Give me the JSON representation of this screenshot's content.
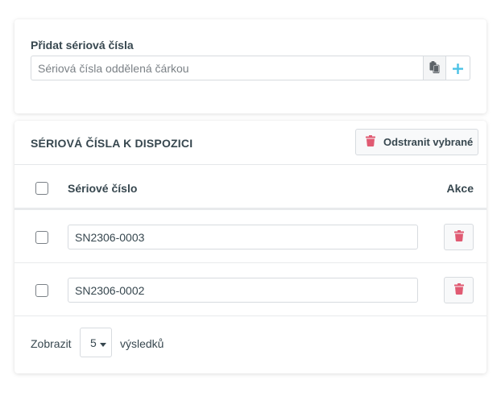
{
  "add_section": {
    "label": "Přidat sériová čísla",
    "input_placeholder": "Sériová čísla oddělená čárkou",
    "input_value": ""
  },
  "list_section": {
    "title": "SÉRIOVÁ ČÍSLA K DISPOZICI",
    "remove_selected_label": "Odstranit vybrané",
    "columns": {
      "serial": "Sériové číslo",
      "actions": "Akce"
    },
    "rows": [
      {
        "serial": "SN2306-0003",
        "checked": false
      },
      {
        "serial": "SN2306-0002",
        "checked": false
      }
    ]
  },
  "footer": {
    "show_label": "Zobrazit",
    "page_size": "5",
    "results_label": "výsledků"
  },
  "icons": {
    "paste": "paste-icon",
    "plus": "plus-icon",
    "trash": "trash-icon",
    "caret": "caret-down-icon"
  },
  "colors": {
    "trash": "#e05a72",
    "plus": "#4fc3e6",
    "text": "#37474f"
  }
}
